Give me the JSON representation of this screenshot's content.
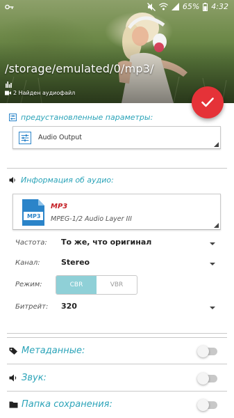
{
  "status_bar": {
    "battery_percent": "65%",
    "time": "4:32"
  },
  "header": {
    "path": "/storage/emulated/0/mp3/",
    "found_text": "2 Найден аудиофайл"
  },
  "presets": {
    "label": "предустановленные параметры:",
    "selected": "Audio Output"
  },
  "audio_info": {
    "label": "Информация об аудио:",
    "format": "MP3",
    "format_icon_text": "MP3",
    "description": "MPEG-1/2 Audio Layer III"
  },
  "options": {
    "frequency": {
      "label": "Частота:",
      "value": "То же, что оригинал"
    },
    "channel": {
      "label": "Канал:",
      "value": "Stereo"
    },
    "mode": {
      "label": "Режим:",
      "options": [
        "CBR",
        "VBR"
      ],
      "selected": "CBR"
    },
    "bitrate": {
      "label": "Битрейт:",
      "value": "320"
    }
  },
  "toggles": [
    {
      "label": "Метаданные:",
      "on": false
    },
    {
      "label": "Звук:",
      "on": false
    },
    {
      "label": "Папка сохранения:",
      "on": false
    }
  ],
  "colors": {
    "accent": "#2aa3b8",
    "fab": "#e53238",
    "format_red": "#c41e24",
    "segment_active": "#8fd0d7"
  }
}
